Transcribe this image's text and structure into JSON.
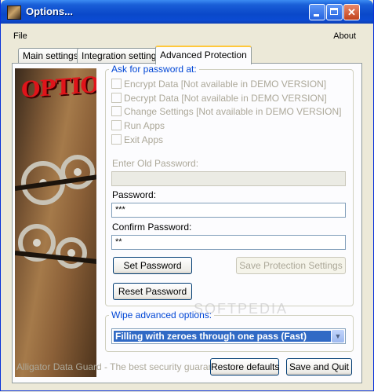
{
  "window": {
    "title": "Options..."
  },
  "menu": {
    "file": "File",
    "about": "About"
  },
  "tabs": [
    {
      "label": "Main settings"
    },
    {
      "label": "Integration settings"
    },
    {
      "label": "Advanced Protection"
    }
  ],
  "side_image": {
    "logo_text": "OPTIONS"
  },
  "password_group": {
    "legend": "Ask for password at:",
    "options": [
      {
        "label": "Encrypt Data [Not available in DEMO VERSION]"
      },
      {
        "label": "Decrypt Data [Not available in DEMO VERSION]"
      },
      {
        "label": "Change Settings [Not available in DEMO VERSION]"
      },
      {
        "label": "Run Apps"
      },
      {
        "label": "Exit Apps"
      }
    ],
    "old_password_label": "Enter Old Password:",
    "old_password_value": "",
    "password_label": "Password:",
    "password_value": "***",
    "confirm_label": "Confirm Password:",
    "confirm_value": "**",
    "set_password": "Set Password",
    "save_protection": "Save Protection Settings",
    "reset_password": "Reset Password"
  },
  "wipe_group": {
    "legend": "Wipe advanced options:",
    "selected": "Filling with zeroes through one pass (Fast)"
  },
  "watermark": "SOFTPEDIA",
  "footer": {
    "tagline": "Alligator Data Guard - The best security guaranteed",
    "restore_defaults": "Restore defaults",
    "save_and_quit": "Save and Quit"
  }
}
